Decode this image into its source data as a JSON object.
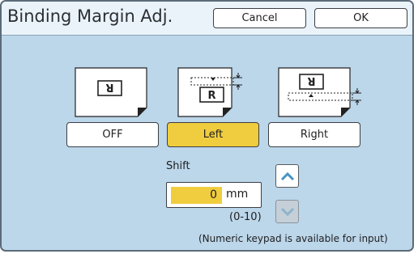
{
  "dialog": {
    "title": "Binding Margin Adj.",
    "cancel_label": "Cancel",
    "ok_label": "OK"
  },
  "modes": [
    {
      "label": "OFF",
      "selected": false,
      "icon": "paper-off-icon"
    },
    {
      "label": "Left",
      "selected": true,
      "icon": "paper-shift-left-icon"
    },
    {
      "label": "Right",
      "selected": false,
      "icon": "paper-shift-right-icon"
    }
  ],
  "shift": {
    "label": "Shift",
    "value": "0",
    "unit": "mm",
    "range": "(0-10)"
  },
  "paper_glyph": "R",
  "note": "(Numeric keypad is available for input)",
  "colors": {
    "panel": "#bcd6ea",
    "header": "#eaf3fa",
    "selected": "#f0cd3e",
    "border": "#5b6b78"
  }
}
